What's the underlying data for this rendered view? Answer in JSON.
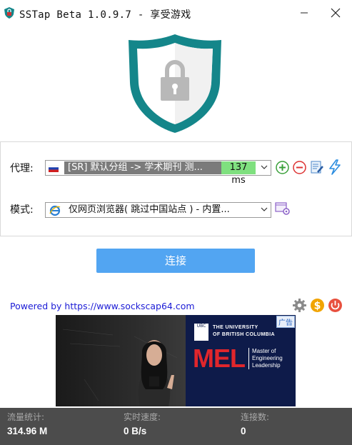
{
  "window": {
    "title": "SSTap Beta 1.0.9.7 - 享受游戏"
  },
  "proxy": {
    "label": "代理:",
    "selected": "[SR] 默认分组 -> 学术期刊 测...",
    "ping": "137 ms",
    "flag_icon": "russia-flag-icon"
  },
  "mode": {
    "label": "模式:",
    "selected": "仅网页浏览器( 跳过中国站点 ) - 内置..."
  },
  "connect": {
    "label": "连接"
  },
  "footer": {
    "powered_by": "Powered by https://www.sockscap64.com"
  },
  "ad": {
    "badge": "广告",
    "ubc_line1": "THE UNIVERSITY",
    "ubc_line2": "OF BRITISH COLUMBIA",
    "logo_lettering": "UBC",
    "headline": "MEL",
    "sub_line1": "Master of",
    "sub_line2": "Engineering",
    "sub_line3": "Leadership"
  },
  "stats": {
    "traffic_label": "流量统计:",
    "traffic_value": "314.96 M",
    "speed_label": "实时速度:",
    "speed_value": "0 B/s",
    "connections_label": "连接数:",
    "connections_value": "0"
  },
  "colors": {
    "shield_teal": "#14868a",
    "connect_blue": "#52a5f2",
    "status_bg": "#4c4c4c",
    "ping_green": "#7fe07f"
  }
}
